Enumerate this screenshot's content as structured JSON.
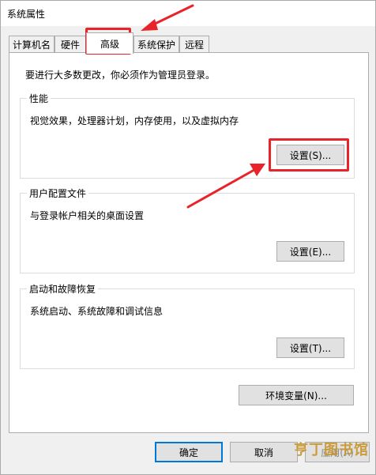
{
  "window": {
    "title": "系统属性"
  },
  "tabs": [
    {
      "label": "计算机名",
      "active": false
    },
    {
      "label": "硬件",
      "active": false
    },
    {
      "label": "高级",
      "active": true
    },
    {
      "label": "系统保护",
      "active": false
    },
    {
      "label": "远程",
      "active": false
    }
  ],
  "notice": "要进行大多数更改，你必须作为管理员登录。",
  "groups": {
    "performance": {
      "title": "性能",
      "description": "视觉效果，处理器计划，内存使用，以及虚拟内存",
      "button": "设置(S)..."
    },
    "user_profiles": {
      "title": "用户配置文件",
      "description": "与登录帐户相关的桌面设置",
      "button": "设置(E)..."
    },
    "startup_recovery": {
      "title": "启动和故障恢复",
      "description": "系统启动、系统故障和调试信息",
      "button": "设置(T)..."
    }
  },
  "env_button": "环境变量(N)...",
  "dialog_buttons": {
    "ok": "确定",
    "cancel": "取消",
    "apply": "应用(A)"
  },
  "watermark": "亨丁图书馆",
  "colors": {
    "annotation": "#e8232a",
    "focus": "#0078d7"
  }
}
